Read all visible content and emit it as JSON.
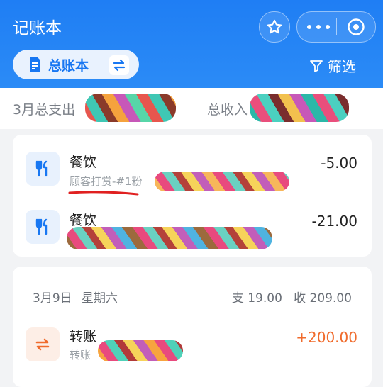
{
  "header": {
    "title": "记账本",
    "ledger_label": "总账本",
    "filter_label": "筛选"
  },
  "summary": {
    "expense_label": "3月总支出",
    "income_label": "总收入"
  },
  "card1": {
    "entries": [
      {
        "category": "餐饮",
        "sub": "顾客打赏-#1粉",
        "amount": "-5.00"
      },
      {
        "category": "餐饮",
        "sub": "",
        "amount": "-21.00"
      }
    ]
  },
  "card2": {
    "date": "3月9日",
    "weekday": "星期六",
    "day_summary": "支 19.00   收 209.00",
    "entries": [
      {
        "category": "转账",
        "sub": "转账",
        "amount": "+200.00"
      }
    ]
  },
  "colors": {
    "brand": "#1f7ef4",
    "income": "#f06b2c",
    "annotation": "#e02020"
  },
  "icons": [
    "star-icon",
    "more-icon",
    "close-circle-icon",
    "document-icon",
    "swap-icon",
    "filter-icon",
    "utensils-icon",
    "transfer-icon"
  ]
}
